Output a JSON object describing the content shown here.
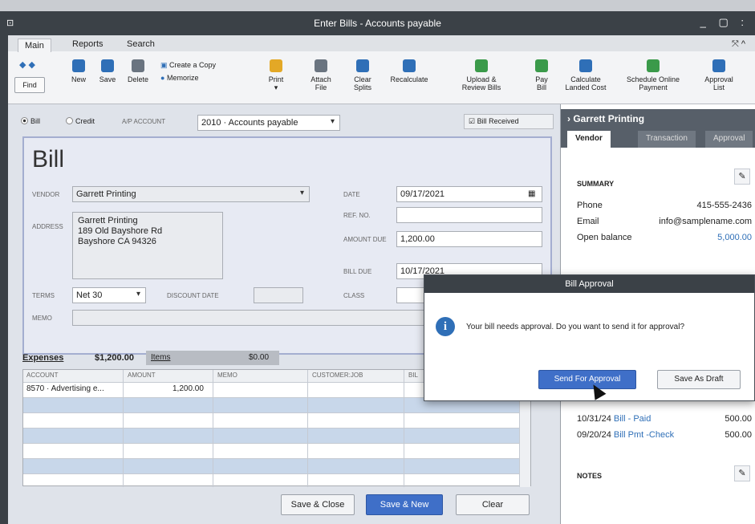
{
  "window": {
    "title": "Enter Bills - Accounts payable",
    "controls": "_ ▢ :"
  },
  "ribbon": {
    "tabs": [
      "Main",
      "Reports",
      "Search"
    ],
    "find": "Find",
    "buttons": {
      "new": "New",
      "save": "Save",
      "delete": "Delete",
      "create_copy": "Create a Copy",
      "memorize": "Memorize",
      "print": "Print",
      "attach_file": [
        "Attach",
        "File"
      ],
      "clear_splits": [
        "Clear",
        "Splits"
      ],
      "recalculate": "Recalculate",
      "upload_review": [
        "Upload &",
        "Review Bills"
      ],
      "pay_bill": [
        "Pay",
        "Bill"
      ],
      "calc_landed": [
        "Calculate",
        "Landed Cost"
      ],
      "schedule_online": [
        "Schedule Online",
        "Payment"
      ],
      "approval_list": [
        "Approval",
        "List"
      ]
    }
  },
  "form": {
    "bill_radio": "Bill",
    "credit_radio": "Credit",
    "ap_account_label": "A/P ACCOUNT",
    "ap_account_value": "2010 · Accounts payable",
    "bill_received_label": "Bill Received",
    "bill_heading": "Bill",
    "vendor_label": "VENDOR",
    "vendor_value": "Garrett Printing",
    "address_label": "ADDRESS",
    "address_lines": [
      "Garrett Printing",
      "189 Old Bayshore Rd",
      "Bayshore CA 94326"
    ],
    "date_label": "DATE",
    "date_value": "09/17/2021",
    "ref_label": "REF. NO.",
    "ref_value": "",
    "amount_due_label": "AMOUNT DUE",
    "amount_due_value": "1,200.00",
    "bill_due_label": "BILL DUE",
    "bill_due_value": "10/17/2021",
    "terms_label": "TERMS",
    "terms_value": "Net 30",
    "discount_date_label": "DISCOUNT DATE",
    "class_label": "CLASS",
    "memo_label": "MEMO"
  },
  "expenses": {
    "expenses_tab": "Expenses",
    "expenses_amount": "$1,200.00",
    "items_tab": "Items",
    "items_amount": "$0.00",
    "columns": [
      "ACCOUNT",
      "AMOUNT",
      "MEMO",
      "CUSTOMER:JOB",
      "BIL"
    ],
    "rows": [
      {
        "account": "8570 · Advertising e...",
        "amount": "1,200.00"
      }
    ]
  },
  "footer_buttons": {
    "save_close": "Save & Close",
    "save_new": "Save & New",
    "clear": "Clear"
  },
  "side_panel": {
    "vendor_name": "Garrett Printing",
    "tabs": [
      "Vendor",
      "Transaction",
      "Approval"
    ],
    "summary_label": "SUMMARY",
    "phone_label": "Phone",
    "phone_value": "415-555-2436",
    "email_label": "Email",
    "email_value": "info@samplename.com",
    "open_balance_label": "Open balance",
    "open_balance_value": "5,000.00",
    "transactions": [
      {
        "date": "10/31/24",
        "type": "Bill",
        "status": "- Paid",
        "amount": "500.00"
      },
      {
        "date": "09/20/24",
        "type": "Bill Pmt -Check",
        "status": "",
        "amount": "500.00"
      }
    ],
    "notes_label": "NOTES"
  },
  "dialog": {
    "title": "Bill Approval",
    "message": "Your bill needs approval. Do you want to send it for approval?",
    "send_button": "Send For Approval",
    "draft_button": "Save As Draft"
  }
}
